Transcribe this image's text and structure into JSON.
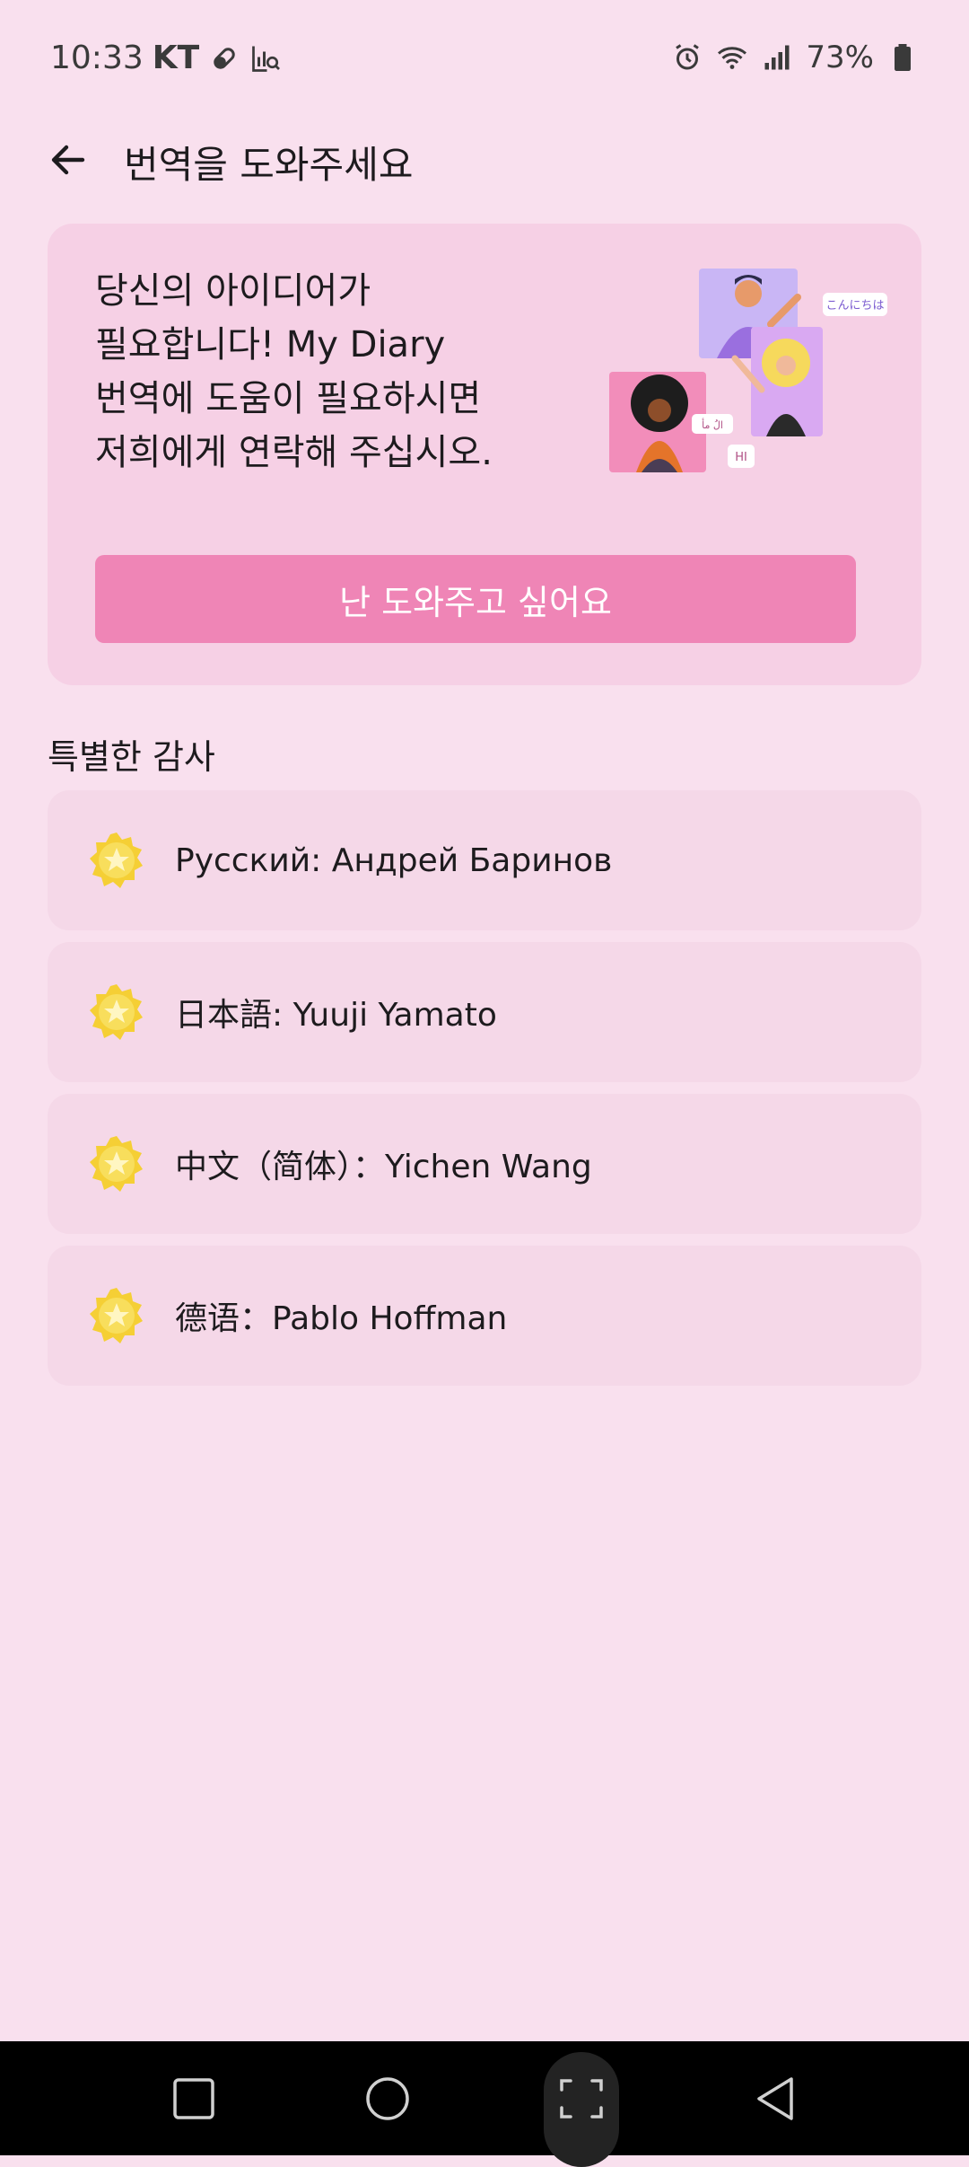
{
  "status_bar": {
    "time": "10:33",
    "carrier": "KT",
    "battery_percent": "73%",
    "icons": [
      "pill-icon",
      "data-search-icon",
      "alarm-icon",
      "wifi-icon",
      "signal-icon",
      "battery-icon"
    ]
  },
  "app_bar": {
    "title": "번역을 도와주세요",
    "back_icon": "arrow-left-icon"
  },
  "help_card": {
    "text": "당신의 아이디어가\n필요합니다! My Diary\n번역에 도움이 필요하시면\n저희에게 연락해 주십시오.",
    "illustration_bubbles": [
      "こんにちは",
      "الُ مأ",
      "HI"
    ],
    "button_label": "난 도와주고 싶어요",
    "accent_color": "#ef85b6"
  },
  "special_thanks": {
    "title": "특별한 감사",
    "items": [
      {
        "label": "Русский: Андрей Баринов",
        "icon": "star-badge-icon"
      },
      {
        "label": "日本語: Yuuji Yamato",
        "icon": "star-badge-icon"
      },
      {
        "label": "中文（简体）：Yichen Wang",
        "icon": "star-badge-icon"
      },
      {
        "label": "德语：Pablo Hoffman",
        "icon": "star-badge-icon"
      }
    ]
  },
  "nav_bar": {
    "buttons": [
      "recents-icon",
      "home-icon",
      "screenshot-icon",
      "back-icon"
    ]
  }
}
